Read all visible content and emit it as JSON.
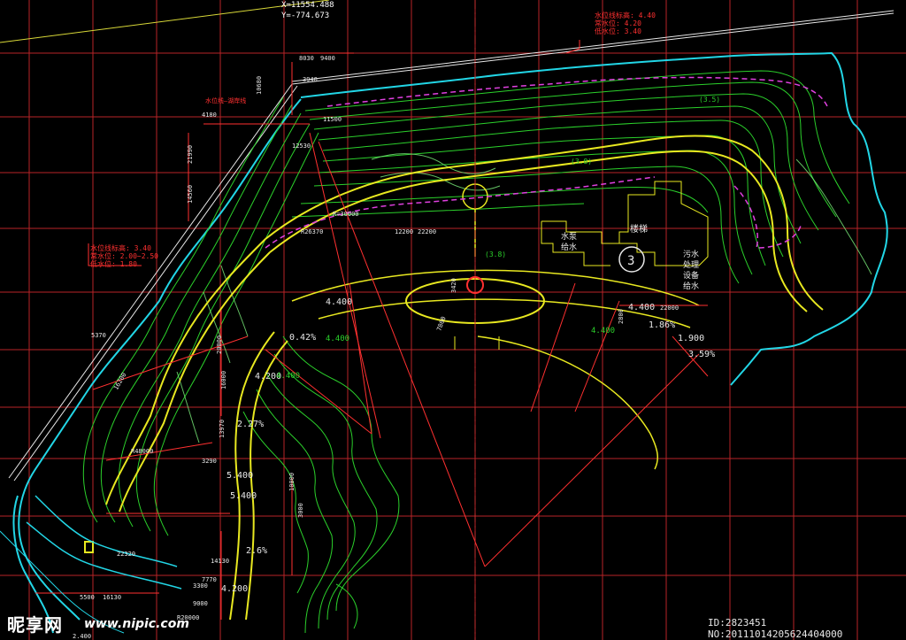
{
  "colors": {
    "background": "#000000",
    "grid": "#c8282a",
    "contour": "#2bd02b",
    "contour_light": "#7cf07c",
    "water": "#20d8e8",
    "road": "#e8e820",
    "boundary": "#e040e0",
    "dimension": "#ff3030",
    "text_white": "#ffffff"
  },
  "coordinates": {
    "x_label": "X=11554.488",
    "y_label": "Y=-774.673"
  },
  "level_box_top": {
    "line1": "水位线标高: 4.40",
    "line2": "常水位: 4.20",
    "line3": "低水位: 3.40"
  },
  "level_box_left": {
    "line1": "水位线标高: 3.40",
    "line2": "常水位: 2.00~2.50",
    "line3": "低水位: 1.80"
  },
  "building_labels": {
    "stairs": "楼梯",
    "pump_label_1": "水泵",
    "pump_label_2": "给水",
    "sewage_1": "污水",
    "sewage_2": "处理",
    "sewage_3": "设备",
    "sewage_4": "给水"
  },
  "circle_number": "3",
  "elevation_labels": [
    "4.400",
    "4.400",
    "4.400",
    "4.200",
    "5.400",
    "5.400",
    "4.200",
    "1.900",
    "4.400",
    "4.400"
  ],
  "slope_labels": [
    "0.42%",
    "2.27%",
    "1.86%",
    "3.59%",
    "2.6%"
  ],
  "dimension_labels": {
    "d1": "8030",
    "d2": "9400",
    "d3": "12530",
    "d4": "3940",
    "d5": "10680",
    "d6": "4180",
    "d7": "21990",
    "d8": "14560",
    "d9": "12200",
    "d10": "R=30000",
    "d11": "R26370",
    "d12": "22200",
    "d13": "3420",
    "d14": "7800",
    "d15": "2800",
    "d16": "22000",
    "d17": "5370",
    "d18": "16200",
    "d19": "20000",
    "d20": "16000",
    "d21": "10000",
    "d22": "3000",
    "d23": "13970",
    "d24": "3290",
    "d25": "R48000",
    "d26": "22320",
    "d27": "14130",
    "d28": "7770",
    "d29": "3300",
    "d30": "5500",
    "d31": "16130",
    "d32": "9000",
    "d33": "R20000",
    "d34": "11500",
    "d35": "2.400"
  },
  "notes": {
    "parenthetical_1": "(3.5)",
    "parenthetical_2": "(3.8)",
    "parenthetical_3": "(3.8)",
    "left_note": "水位线—湖岸线"
  },
  "watermark": {
    "logo": "昵享网",
    "url": "www.nipic.com",
    "id_text": "ID:2823451 NO:20111014205624404000"
  }
}
